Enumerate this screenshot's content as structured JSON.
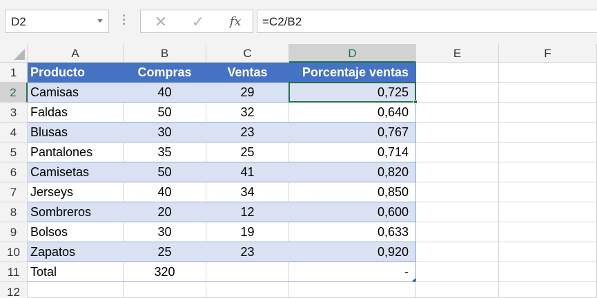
{
  "formula_bar": {
    "name_box": "D2",
    "formula": "=C2/B2",
    "icons": [
      "close-icon",
      "check-icon",
      "fx-icon"
    ],
    "fx_label": "fx"
  },
  "columns": [
    "A",
    "B",
    "C",
    "D",
    "E",
    "F"
  ],
  "rows": [
    "1",
    "2",
    "3",
    "4",
    "5",
    "6",
    "7",
    "8",
    "9",
    "10",
    "11",
    "12"
  ],
  "selected_cell": "D2",
  "table": {
    "headers": [
      "Producto",
      "Compras",
      "Ventas",
      "Porcentaje ventas"
    ],
    "rows": [
      [
        "Camisas",
        "40",
        "29",
        "0,725"
      ],
      [
        "Faldas",
        "50",
        "32",
        "0,640"
      ],
      [
        "Blusas",
        "30",
        "23",
        "0,767"
      ],
      [
        "Pantalones",
        "35",
        "25",
        "0,714"
      ],
      [
        "Camisetas",
        "50",
        "41",
        "0,820"
      ],
      [
        "Jerseys",
        "40",
        "34",
        "0,850"
      ],
      [
        "Sombreros",
        "20",
        "12",
        "0,600"
      ],
      [
        "Bolsos",
        "30",
        "19",
        "0,633"
      ],
      [
        "Zapatos",
        "25",
        "23",
        "0,920"
      ]
    ],
    "total_row": [
      "Total",
      "320",
      "",
      "-"
    ]
  },
  "colors": {
    "header_fill": "#4472c4",
    "band_fill": "#d9e1f2",
    "selection": "#217346"
  }
}
